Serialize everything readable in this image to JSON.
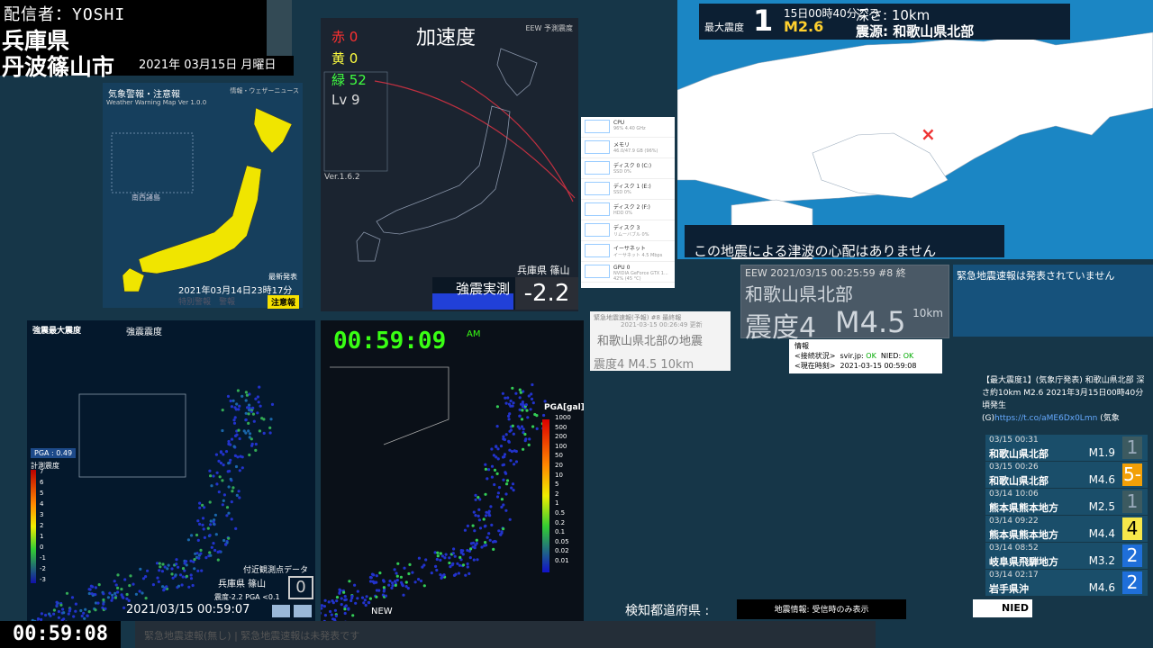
{
  "header": {
    "broadcaster": "配信者：YOSHI",
    "prefecture": "兵庫県",
    "city": "丹波篠山市",
    "date": "2021年 03月15日 月曜日"
  },
  "warning": {
    "title": "気象警報・注意報",
    "source": "情報・ウェザーニュース",
    "subtitle": "Weather Warning Map  Ver 1.0.0",
    "islands": "南西諸島",
    "latest_label": "最新発表",
    "issued": "2021年03月14日23時17分",
    "dim_labels": "特別警報　警報",
    "badge": "注意報"
  },
  "accel": {
    "title": "加速度",
    "red": "赤 0",
    "yellow": "黄 0",
    "green": "緑 52",
    "level": "Lv 9",
    "eew_label": "EEW 予測震度",
    "version": "Ver.1.6.2",
    "location": "兵庫県 篠山",
    "shindo_label": "強震実測",
    "shindo_value": "-2.2"
  },
  "perf": [
    {
      "name": "CPU",
      "detail": "96% 4.40 GHz"
    },
    {
      "name": "メモリ",
      "detail": "46.0/47.9 GB (96%)"
    },
    {
      "name": "ディスク 0 (C:)",
      "detail": "SSD 0%"
    },
    {
      "name": "ディスク 1 (E:)",
      "detail": "SSD 0%"
    },
    {
      "name": "ディスク 2 (F:)",
      "detail": "HDD 0%"
    },
    {
      "name": "ディスク 3",
      "detail": "リムーバブル 0%"
    },
    {
      "name": "イーサネット",
      "detail": "イーサネット 4.5 Mbps"
    },
    {
      "name": "GPU 0",
      "detail": "NVIDIA GeForce GTX 1... 42% (45 °C)"
    }
  ],
  "quake": {
    "max_label": "最大震度",
    "max_value": "1",
    "time": "15日00時40分ごろ",
    "magnitude": "M2.6",
    "depth": "深さ: 10km",
    "epicenter": "震源: 和歌山県北部",
    "tsunami": "この地震による津波の心配はありません"
  },
  "eew": {
    "header": "EEW  2021/03/15 00:25:59  #8 終",
    "area": "和歌山県北部",
    "shindo": "震度4",
    "mag": "M4.5",
    "depth": "10km"
  },
  "no_eew": "緊急地震速報は発表されていません",
  "eqinfo": {
    "header": "緊急地震速報(予報)  #8 最終報",
    "updated": "2021-03-15 00:26:49 更新",
    "title": "和歌山県北部の地震",
    "line": "震度4    M4.5    10km"
  },
  "status": {
    "title": "情報",
    "conn_label": "<接続状況>",
    "svir": "svir.jp:",
    "svir_ok": "OK",
    "nied": "NIED:",
    "nied_ok": "OK",
    "time_label": "<現在時刻>",
    "time": "2021-03-15 00:59:08"
  },
  "tweet": {
    "text": "【最大震度1】(気象庁発表) 和歌山県北部 深さ約10km M2.6 2021年3月15日00時40分頃発生",
    "prefix": "(G)",
    "link": "https://t.co/aME6Dx0Lmn",
    "suffix": "(気象"
  },
  "history": [
    {
      "date": "03/15 00:31",
      "place": "和歌山県北部",
      "mag": "M1.9",
      "shindo": "1",
      "bg": "#3c5a60",
      "fg": "#9ab"
    },
    {
      "date": "03/15 00:26",
      "place": "和歌山県北部",
      "mag": "M4.6",
      "shindo": "5-",
      "bg": "#f2a007",
      "fg": "#fff"
    },
    {
      "date": "03/14 10:06",
      "place": "熊本県熊本地方",
      "mag": "M2.5",
      "shindo": "1",
      "bg": "#3c5a60",
      "fg": "#9ab"
    },
    {
      "date": "03/14 09:22",
      "place": "熊本県熊本地方",
      "mag": "M4.4",
      "shindo": "4",
      "bg": "#f7e74a",
      "fg": "#000"
    },
    {
      "date": "03/14 08:52",
      "place": "岐阜県飛騨地方",
      "mag": "M3.2",
      "shindo": "2",
      "bg": "#1f6fd9",
      "fg": "#fff"
    },
    {
      "date": "03/14 02:17",
      "place": "岩手県沖",
      "mag": "M4.6",
      "shindo": "2",
      "bg": "#1f6fd9",
      "fg": "#fff"
    }
  ],
  "kmap": {
    "title1": "強震最大震度",
    "title2": "強震震度",
    "pga": "PGA : 0.49",
    "scale": "計測震度",
    "near": "付近観測点データ",
    "loc": "兵庫県 篠山",
    "vals": "震度-2.2  PGA <0.1",
    "box": "0",
    "datetime": "2021/03/15 00:59:07",
    "scale_ticks": [
      "7",
      "6",
      "5",
      "4",
      "3",
      "2",
      "1",
      "0",
      "-1",
      "-2",
      "-3"
    ]
  },
  "pmap": {
    "clock": "00:59:09",
    "ampm": "AM",
    "scale": "PGA[gal]",
    "new": "NEW",
    "ticks": [
      "1000",
      "500",
      "200",
      "100",
      "50",
      "20",
      "10",
      "5",
      "2",
      "1",
      "0.5",
      "0.2",
      "0.1",
      "0.05",
      "0.02",
      "0.01"
    ]
  },
  "bottom": {
    "clock": "00:59:08",
    "bar": "緊急地震速報(無し) |  緊急地震速報は未発表です",
    "ken": "検知都道府県 :",
    "ticker": "地震情報: 受信時のみ表示",
    "nied": "NIED"
  }
}
